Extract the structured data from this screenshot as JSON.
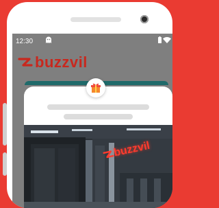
{
  "status_bar": {
    "time": "12:30",
    "icons": [
      "ghost-icon",
      "battery-icon",
      "wifi-icon"
    ]
  },
  "app": {
    "brand_name": "buzzvil",
    "brand_color": "#c8281e"
  },
  "reward_card": {
    "badge_icon": "gift-icon",
    "photo_sign_text": "buzzvil"
  },
  "colors": {
    "background": "#ea3b32",
    "accent": "#1f6a6a"
  }
}
